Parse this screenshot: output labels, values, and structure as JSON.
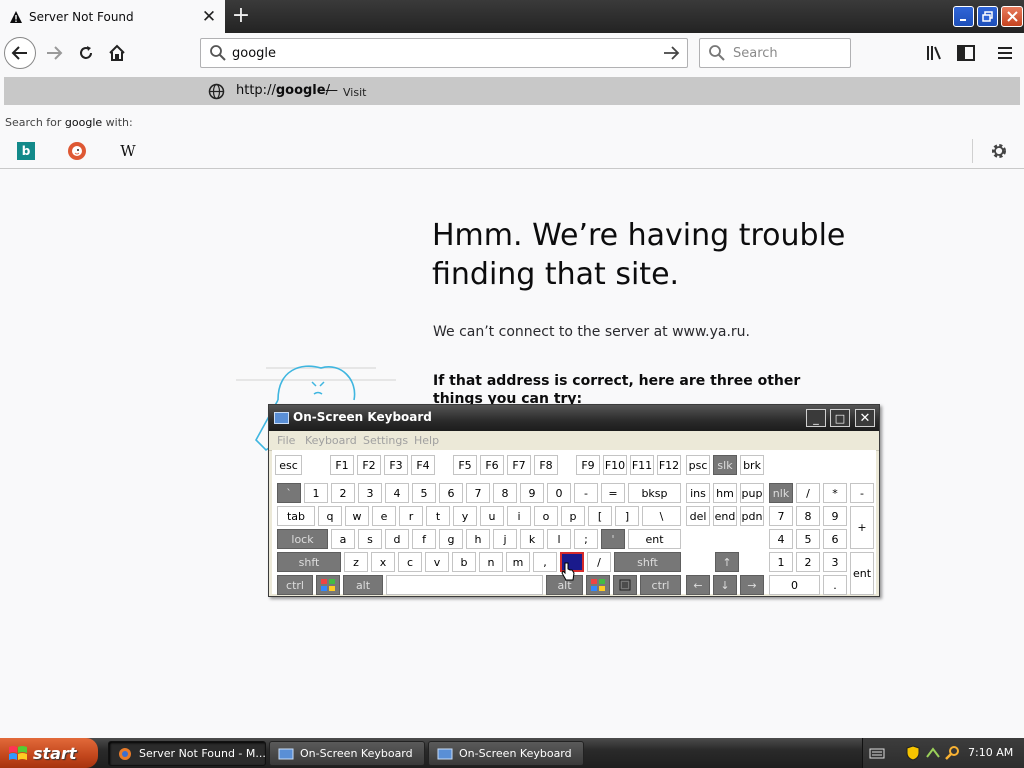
{
  "browser": {
    "tab": {
      "title": "Server Not Found",
      "close_glyph": "✕"
    },
    "newtab_glyph": "+",
    "url": {
      "value": "google"
    },
    "search": {
      "placeholder": "Search"
    }
  },
  "popup": {
    "suggestion": {
      "url_prefix": "http://",
      "url_bold": "google",
      "url_suffix": "/",
      "separator": "—",
      "action": "Visit"
    },
    "search_with_prefix": "Search for ",
    "search_with_query": "google",
    "search_with_suffix": " with:",
    "engines": [
      "bing-icon",
      "duckduckgo-icon",
      "wikipedia-icon"
    ],
    "wiki_glyph": "W",
    "bing_glyph": "b"
  },
  "page": {
    "title": "Hmm. We’re having trouble finding that site.",
    "description": "We can’t connect to the server at www.ya.ru.",
    "subheading": "If that address is correct, here are three other things you can try:"
  },
  "osk": {
    "title": "On-Screen Keyboard",
    "menu": [
      "File",
      "Keyboard",
      "Settings",
      "Help"
    ],
    "buttons": {
      "min": "_",
      "max": "□",
      "close": "✕"
    }
  },
  "taskbar": {
    "start": "start",
    "tasks": [
      "Server Not Found - M...",
      "On-Screen Keyboard",
      "On-Screen Keyboard"
    ],
    "clock": "7:10 AM"
  },
  "colors": {
    "titlebar": "#2b2b2b",
    "suggestion_highlight": "#c8c8c8",
    "osk_selected_key": "#1a1a8c",
    "osk_selected_border": "#d62b2b",
    "start_button": "#c2461c"
  }
}
